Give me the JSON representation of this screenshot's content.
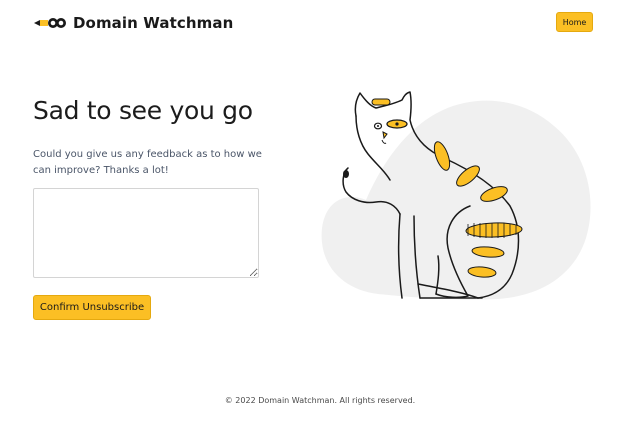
{
  "brand": {
    "name": "Domain Watchman",
    "logo_icon": "pencil-logo-icon"
  },
  "nav": {
    "home_label": "Home"
  },
  "main": {
    "heading": "Sad to see you go",
    "feedback_prompt": "Could you give us any feedback as to how we can improve? Thanks a lot!",
    "feedback_value": "",
    "feedback_placeholder": "",
    "confirm_label": "Confirm Unsubscribe"
  },
  "illustration": {
    "icon": "cat-illustration",
    "accent_color": "#fbbf24",
    "blob_color": "#f0f0f0"
  },
  "footer": {
    "copyright": "© 2022 Domain Watchman. All rights reserved."
  },
  "colors": {
    "accent": "#fbbf24",
    "text_dark": "#1c1c1c",
    "text_muted": "#4a5568"
  }
}
